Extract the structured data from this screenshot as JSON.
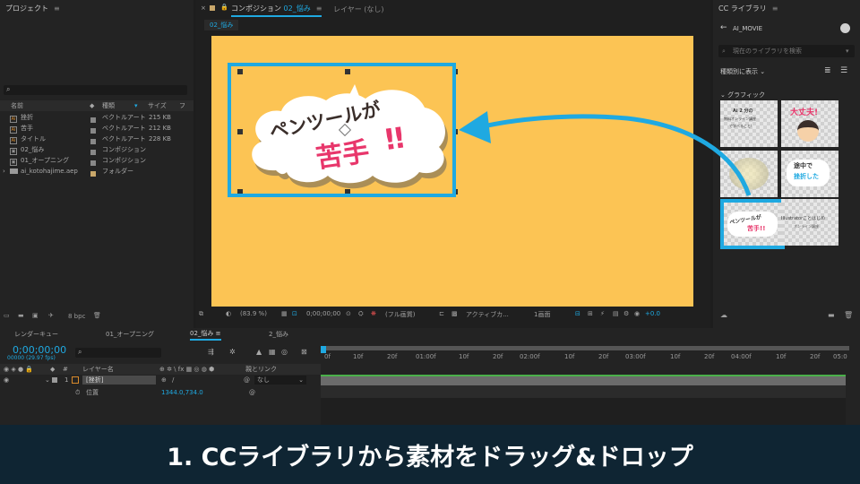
{
  "project": {
    "title": "プロジェクト",
    "search_icon": "⌕",
    "columns": [
      "名前",
      "種類",
      "サイズ",
      "フ"
    ],
    "items": [
      {
        "name": "挫折",
        "type": "ベクトルアート",
        "size": "215 KB",
        "icon": "ai-file-icon"
      },
      {
        "name": "苦手",
        "type": "ベクトルアート",
        "size": "212 KB",
        "icon": "ai-file-icon"
      },
      {
        "name": "タイトル",
        "type": "ベクトルアート",
        "size": "228 KB",
        "icon": "ai-file-icon"
      },
      {
        "name": "02_悩み",
        "type": "コンポジション",
        "size": "",
        "icon": "composition-icon"
      },
      {
        "name": "01_オープニング",
        "type": "コンポジション",
        "size": "",
        "icon": "composition-icon"
      },
      {
        "name": "ai_kotohajime.aep",
        "type": "フォルダー",
        "size": "",
        "icon": "folder-icon"
      }
    ],
    "bpc": "8 bpc"
  },
  "comp": {
    "tab_label": "コンポジション",
    "tab_comp_name": "02_悩み",
    "layer_tab": "レイヤー (なし)",
    "breadcrumb": "02_悩み",
    "bubble_line1": "ペンツールが",
    "bubble_line2": "苦手",
    "bubble_marks": "!!",
    "zoom": "(83.9 %)",
    "timecode": "0;00;00;00",
    "resolution": "(フル画質)",
    "camera": "アクティブカ...",
    "views": "1画面",
    "exposure": "+0.0",
    "background_color": "#fcc454"
  },
  "library": {
    "title": "CC ライブラリ",
    "name": "AI_MOVIE",
    "search_placeholder": "現在のライブラリを検索",
    "view_by": "種類別に表示",
    "section": "グラフィック",
    "thumbs": [
      {
        "line1": "Ai 2 分の",
        "line2": "無料オンライン講座",
        "line3": "で学べること!"
      },
      {
        "line1": "大丈夫!",
        "line2": "",
        "line3": ""
      },
      {
        "line1": "",
        "line2": "",
        "line3": ""
      },
      {
        "line1": "途中で",
        "line2": "挫折した",
        "line3": ""
      },
      {
        "line1": "ペンツールが",
        "line2": "苦手!!",
        "line3": ""
      },
      {
        "line1": "Illustratorことはじめ",
        "line2": "オンライン講座",
        "line3": ""
      }
    ]
  },
  "timeline": {
    "tabs": [
      "レンダーキュー",
      "01_オープニング",
      "02_悩み",
      "2_悩み"
    ],
    "timecode": "0;00;00;00",
    "frame_info": "00000 (29.97 fps)",
    "search_icon": "⌕",
    "col_layer": "レイヤー名",
    "col_parent": "親とリンク",
    "ticks": [
      "0f",
      "10f",
      "20f",
      "01:00f",
      "10f",
      "20f",
      "02:00f",
      "10f",
      "20f",
      "03:00f",
      "10f",
      "20f",
      "04:00f",
      "10f",
      "20f",
      "05:0"
    ],
    "layer": {
      "num": "1",
      "name": "[挫折]",
      "parent": "なし"
    },
    "property": {
      "name": "位置",
      "value": "1344.0,734.0"
    }
  },
  "caption": "1. CCライブラリから素材をドラッグ&ドロップ",
  "colors": {
    "accent_blue": "#1fa9e1",
    "caption_bg": "#0f2533",
    "bubble_text_dark": "#3a2e2a",
    "bubble_text_pink": "#e8366b"
  }
}
